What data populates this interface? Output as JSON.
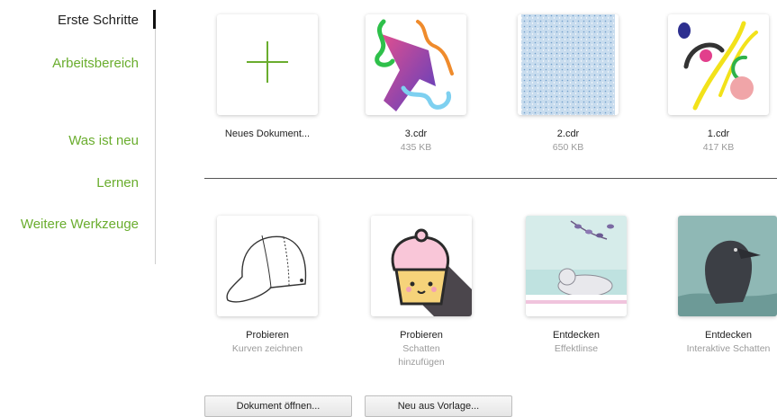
{
  "sidebar": {
    "items": [
      {
        "label": "Erste Schritte",
        "active": true
      },
      {
        "label": "Arbeitsbereich"
      },
      {
        "label": "Was ist neu"
      },
      {
        "label": "Lernen"
      },
      {
        "label": "Weitere Werkzeuge"
      }
    ]
  },
  "recent": [
    {
      "name": "Neues Dokument...",
      "icon": "plus-icon"
    },
    {
      "name": "3.cdr",
      "size": "435 KB"
    },
    {
      "name": "2.cdr",
      "size": "650 KB"
    },
    {
      "name": "1.cdr",
      "size": "417 KB"
    }
  ],
  "tutorials": [
    {
      "name": "Probieren",
      "desc_line1": "Kurven zeichnen",
      "desc_line2": ""
    },
    {
      "name": "Probieren",
      "desc_line1": "Schatten",
      "desc_line2": "hinzufügen"
    },
    {
      "name": "Entdecken",
      "desc_line1": "Effektlinse",
      "desc_line2": ""
    },
    {
      "name": "Entdecken",
      "desc_line1": "Interaktive Schatten",
      "desc_line2": ""
    }
  ],
  "buttons": {
    "open_document": "Dokument öffnen...",
    "new_from_template": "Neu aus Vorlage..."
  },
  "colors": {
    "accent_green": "#6aad2e",
    "active_text": "#222222",
    "muted_text": "#9a9a9a"
  }
}
